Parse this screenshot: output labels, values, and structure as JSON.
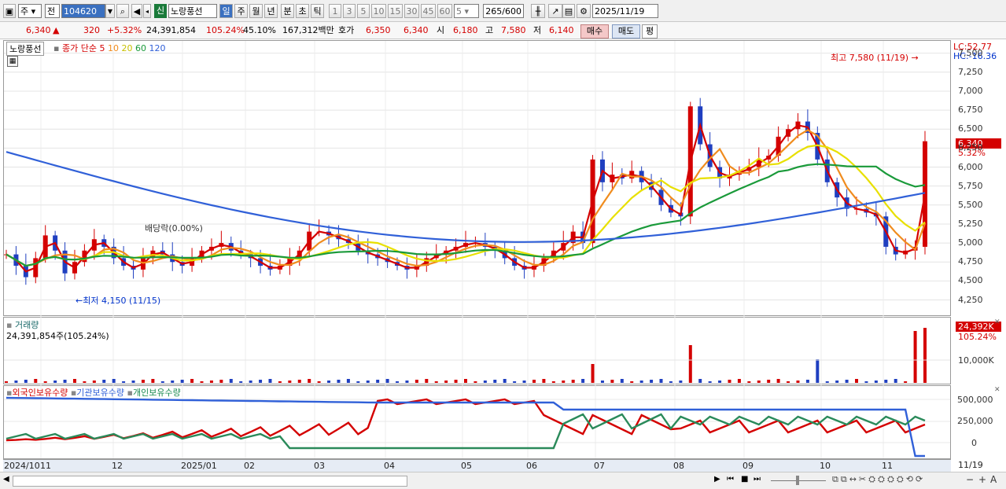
{
  "toolbar": {
    "type": "주",
    "market": "전",
    "code": "104620",
    "mode_badge": "신",
    "name": "노랑풍선",
    "periods": [
      "일",
      "주",
      "월",
      "년",
      "분",
      "초",
      "틱"
    ],
    "intervals": [
      "1",
      "3",
      "5",
      "10",
      "15",
      "30",
      "45",
      "60"
    ],
    "count_select": "5",
    "count": "265",
    "count_total": "/600",
    "date": "2025/11/19"
  },
  "quote": {
    "price": "6,340",
    "change_arrow": "▲",
    "change": "320",
    "rate": "+5.32%",
    "volume": "24,391,854",
    "volume_ratio": "105.24%",
    "turnover": "45.10%",
    "amount": "167,312백만",
    "bid_label": "호가",
    "bid1": "6,350",
    "bid2": "6,340",
    "open_label": "시",
    "open": "6,180",
    "high_label": "고",
    "high": "7,580",
    "low_label": "저",
    "low": "6,140",
    "buy_label": "매수",
    "sell_label": "매도",
    "avg_label": "평"
  },
  "price_panel": {
    "name": "노랑풍선",
    "legend_title": "종가 단순",
    "ma_labels": [
      "5",
      "10",
      "20",
      "60",
      "120"
    ],
    "ma_colors": [
      "#d40000",
      "#f08c1e",
      "#e8e000",
      "#1a9a3a",
      "#3060d8"
    ],
    "lc": "LC:52.77",
    "hc": "HC:-16.36",
    "high_note": "최고 7,580 (11/19)",
    "low_note": "최저 4,150 (11/15)",
    "dividend_note": "배당락(0.00%)",
    "current_price": "6,340",
    "current_rate": "5.32%",
    "yticks": [
      "7,500",
      "7,250",
      "7,000",
      "6,750",
      "6,500",
      "6,250",
      "6,000",
      "5,750",
      "5,500",
      "5,250",
      "5,000",
      "4,750",
      "4,500",
      "4,250"
    ]
  },
  "volume_panel": {
    "title": "거래량",
    "value": "24,391,854주(105.24%)",
    "badge": "24,392K",
    "badge_rate": "105.24%",
    "ytick": "10,000K"
  },
  "holding_panel": {
    "legends": [
      "외국인보유수량",
      "기관보유수량",
      "개인보유수량"
    ],
    "legend_colors": [
      "#d40000",
      "#3060d8",
      "#1a8a50"
    ],
    "yticks": [
      "500,000",
      "250,000",
      "0"
    ]
  },
  "x_axis": {
    "labels": [
      "2024/10",
      "11",
      "12",
      "2025/01",
      "02",
      "03",
      "04",
      "05",
      "06",
      "07",
      "08",
      "09",
      "10",
      "11"
    ],
    "right_label": "11/19"
  },
  "chart_data": {
    "type": "candlestick",
    "title": "노랑풍선",
    "ylim": [
      4100,
      7600
    ],
    "close_series": [
      4850,
      4700,
      4550,
      4800,
      5100,
      4900,
      4600,
      4750,
      4900,
      5050,
      4950,
      4800,
      4700,
      4650,
      4800,
      4900,
      4850,
      4750,
      4700,
      4800,
      4900,
      4950,
      5000,
      4900,
      4850,
      4800,
      4700,
      4650,
      4700,
      4800,
      4900,
      5150,
      5150,
      5100,
      5050,
      5000,
      4900,
      4850,
      4800,
      4750,
      4700,
      4650,
      4700,
      4800,
      4850,
      4900,
      4950,
      5000,
      5000,
      4950,
      4900,
      4800,
      4700,
      4650,
      4700,
      4800,
      4900,
      5000,
      5150,
      5000,
      6100,
      5800,
      5900,
      5850,
      5950,
      5800,
      5700,
      5500,
      5400,
      5350,
      6800,
      6300,
      6000,
      5850,
      5900,
      5950,
      6000,
      6100,
      6150,
      6400,
      6500,
      6600,
      6450,
      6100,
      5800,
      5600,
      5450,
      5450,
      5400,
      5350,
      4950,
      4850,
      4900,
      4950,
      6340
    ],
    "ma120_start": 6200,
    "ma120_end": 5660
  }
}
